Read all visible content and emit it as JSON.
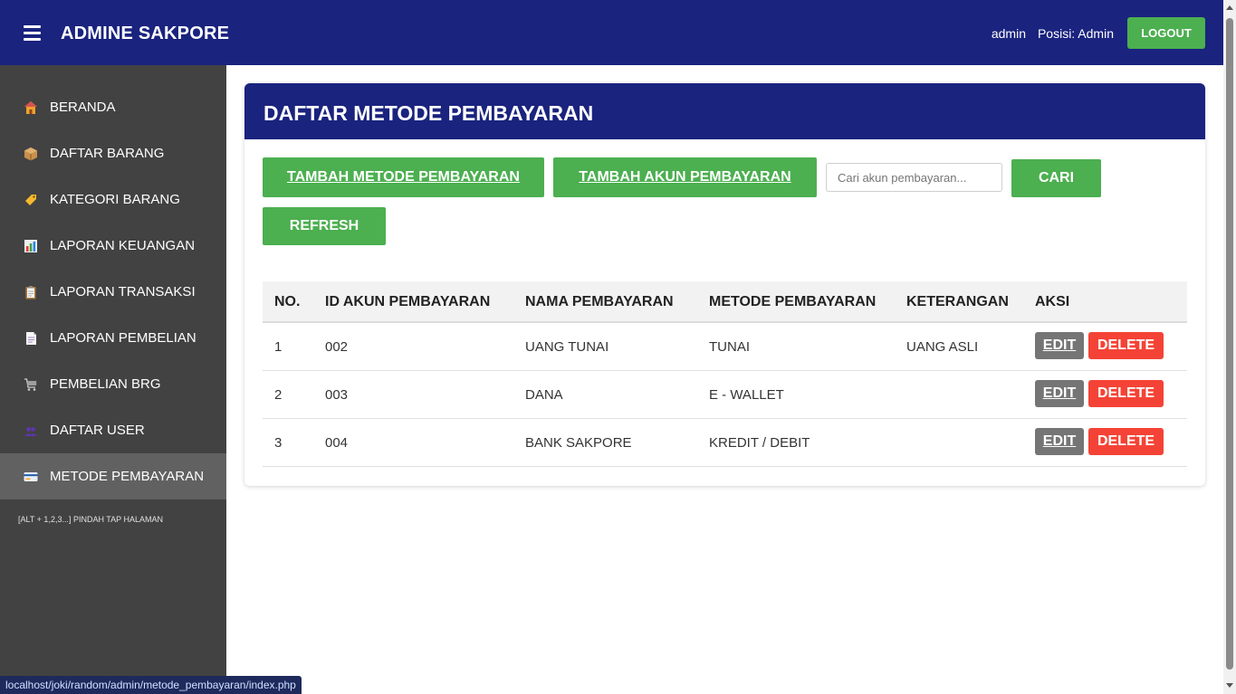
{
  "header": {
    "brand": "ADMINE SAKPORE",
    "user_name": "admin",
    "user_role": "Posisi: Admin",
    "logout_label": "LOGOUT"
  },
  "sidebar": {
    "items": [
      {
        "label": "BERANDA",
        "icon": "house-icon"
      },
      {
        "label": "DAFTAR BARANG",
        "icon": "package-icon"
      },
      {
        "label": "KATEGORI BARANG",
        "icon": "label-tag-icon"
      },
      {
        "label": "LAPORAN KEUANGAN",
        "icon": "bar-chart-icon"
      },
      {
        "label": "LAPORAN TRANSAKSI",
        "icon": "clipboard-icon"
      },
      {
        "label": "LAPORAN PEMBELIAN",
        "icon": "document-icon"
      },
      {
        "label": "PEMBELIAN BRG",
        "icon": "cart-icon"
      },
      {
        "label": "DAFTAR USER",
        "icon": "users-icon"
      },
      {
        "label": "METODE PEMBAYARAN",
        "icon": "credit-card-icon"
      }
    ],
    "active_index": 8,
    "hint": "[ALT + 1,2,3...] PINDAH TAP HALAMAN"
  },
  "main": {
    "title": "DAFTAR METODE PEMBAYARAN",
    "add_method_label": "TAMBAH METODE PEMBAYARAN",
    "add_account_label": "TAMBAH AKUN PEMBAYARAN",
    "search_placeholder": "Cari akun pembayaran...",
    "search_label": "CARI",
    "refresh_label": "REFRESH"
  },
  "table": {
    "headers": [
      "NO.",
      "ID AKUN PEMBAYARAN",
      "NAMA PEMBAYARAN",
      "METODE PEMBAYARAN",
      "KETERANGAN",
      "AKSI"
    ],
    "rows": [
      {
        "no": "1",
        "id": "002",
        "nama": "UANG TUNAI",
        "metode": "TUNAI",
        "keterangan": "UANG ASLI"
      },
      {
        "no": "2",
        "id": "003",
        "nama": "DANA",
        "metode": "E - WALLET",
        "keterangan": ""
      },
      {
        "no": "3",
        "id": "004",
        "nama": "BANK SAKPORE",
        "metode": "KREDIT / DEBIT",
        "keterangan": ""
      }
    ],
    "edit_label": "EDIT",
    "delete_label": "DELETE"
  },
  "status_url": "localhost/joki/random/admin/metode_pembayaran/index.php",
  "colors": {
    "primary": "#1a237e",
    "success": "#4caf50",
    "danger": "#f44336",
    "sidebar": "#424242",
    "sidebar_active": "#616161"
  }
}
